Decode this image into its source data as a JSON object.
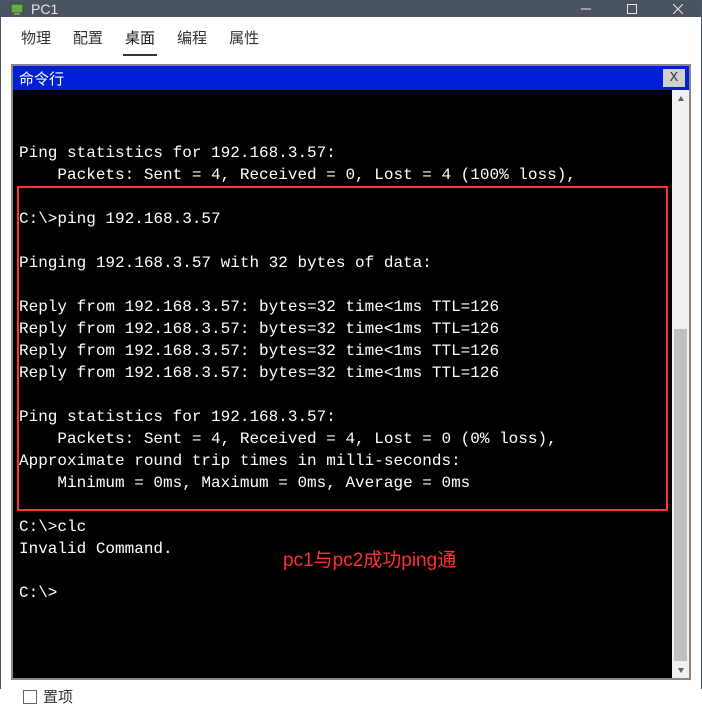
{
  "titlebar": {
    "title": "PC1"
  },
  "tabs": {
    "items": [
      "物理",
      "配置",
      "桌面",
      "编程",
      "属性"
    ],
    "active_index": 2
  },
  "cmd_header": {
    "title": "命令行",
    "close": "X"
  },
  "terminal": {
    "lines": [
      "Ping statistics for 192.168.3.57:",
      "    Packets: Sent = 4, Received = 0, Lost = 4 (100% loss),",
      "",
      "C:\\>ping 192.168.3.57",
      "",
      "Pinging 192.168.3.57 with 32 bytes of data:",
      "",
      "Reply from 192.168.3.57: bytes=32 time<1ms TTL=126",
      "Reply from 192.168.3.57: bytes=32 time<1ms TTL=126",
      "Reply from 192.168.3.57: bytes=32 time<1ms TTL=126",
      "Reply from 192.168.3.57: bytes=32 time<1ms TTL=126",
      "",
      "Ping statistics for 192.168.3.57:",
      "    Packets: Sent = 4, Received = 4, Lost = 0 (0% loss),",
      "Approximate round trip times in milli-seconds:",
      "    Minimum = 0ms, Maximum = 0ms, Average = 0ms",
      "",
      "C:\\>clc",
      "Invalid Command.",
      "",
      "C:\\>"
    ]
  },
  "annotation": "pc1与pc2成功ping通",
  "footer": {
    "checkbox_label": "置项"
  }
}
